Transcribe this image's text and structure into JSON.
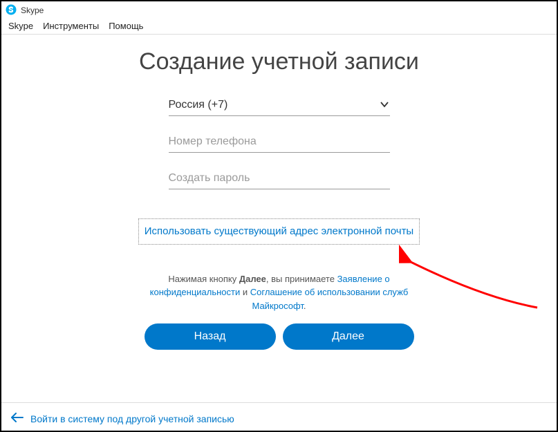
{
  "window": {
    "title": "Skype"
  },
  "menu": {
    "skype": "Skype",
    "tools": "Инструменты",
    "help": "Помощь"
  },
  "main": {
    "heading": "Создание учетной записи",
    "country_selected": "Россия (+7)",
    "phone_placeholder": "Номер телефона",
    "password_placeholder": "Создать пароль",
    "use_email_link": "Использовать существующий адрес электронной почты"
  },
  "legal": {
    "prefix": "Нажимая кнопку ",
    "next_bold": "Далее",
    "mid1": ", вы принимаете ",
    "link1": "Заявление о конфиденциальности",
    "mid2": " и ",
    "link2": "Соглашение об использовании служб Майкрософт",
    "suffix": "."
  },
  "buttons": {
    "back": "Назад",
    "next": "Далее"
  },
  "footer": {
    "other_account": "Войти в систему под другой учетной записью"
  }
}
